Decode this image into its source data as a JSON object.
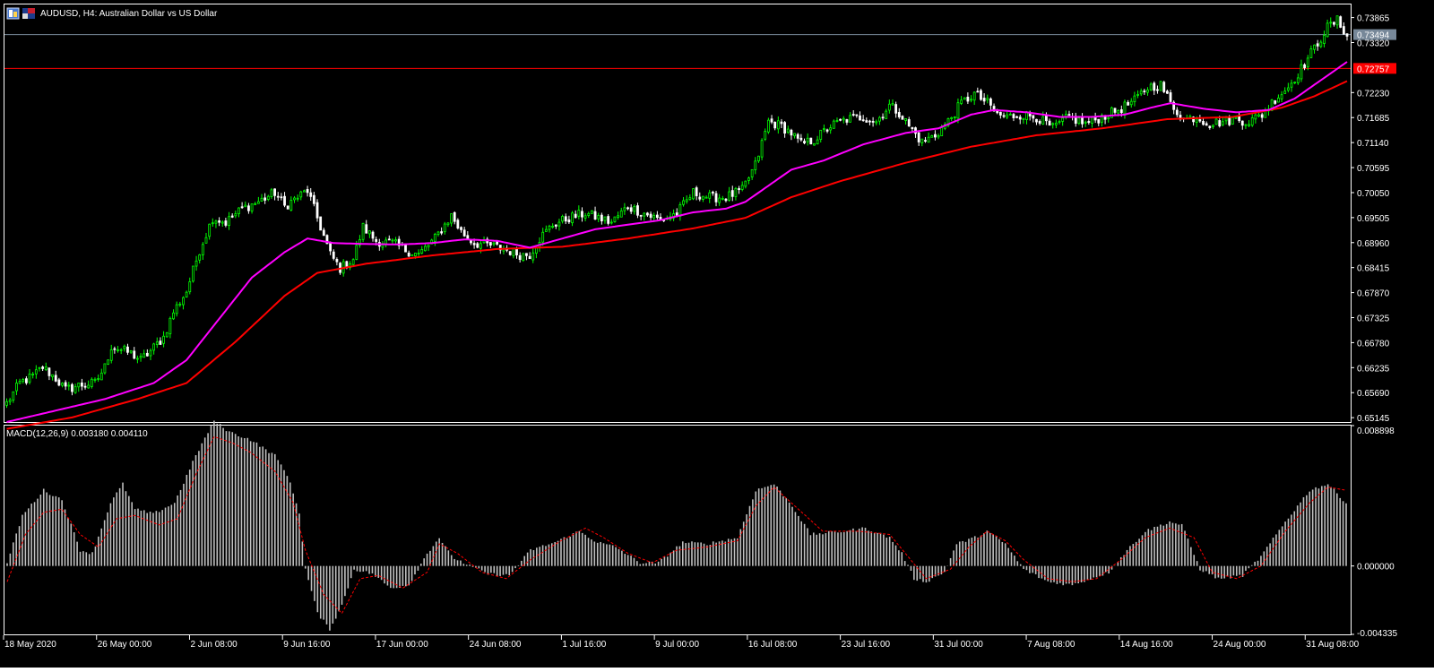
{
  "header": {
    "symbol_title": "AUDUSD, H4:  Australian Dollar vs US Dollar"
  },
  "colors": {
    "background": "#000000",
    "frame": "#ffffff",
    "text": "#ffffff",
    "bull_candle": "#00ff00",
    "bear_candle": "#ffffff",
    "ma_fast": "#ff00ff",
    "ma_slow": "#ff0000",
    "bid_line": "#778899",
    "ask_line": "#ff0000",
    "macd_histogram": "#c0c0c0",
    "macd_signal": "#ff0000"
  },
  "chart_data": [
    {
      "type": "candlestick",
      "name": "price",
      "title": "AUDUSD, H4:  Australian Dollar vs US Dollar",
      "ylim": [
        0.6505,
        0.7415
      ],
      "y_ticks": [
        "0.73865",
        "0.73320",
        "0.72230",
        "0.71685",
        "0.71140",
        "0.70595",
        "0.70050",
        "0.69505",
        "0.68960",
        "0.68415",
        "0.67870",
        "0.67325",
        "0.66780",
        "0.66235",
        "0.65690",
        "0.65145"
      ],
      "bid_label": "0.73494",
      "bid_value": 0.73494,
      "ask_label": "0.72757",
      "ask_value": 0.72757,
      "grid": false,
      "close_path": [
        [
          0,
          0.6546
        ],
        [
          4,
          0.659
        ],
        [
          8,
          0.6605
        ],
        [
          11,
          0.6625
        ],
        [
          15,
          0.66
        ],
        [
          18,
          0.6575
        ],
        [
          22,
          0.6585
        ],
        [
          27,
          0.659
        ],
        [
          30,
          0.6625
        ],
        [
          32,
          0.667
        ],
        [
          38,
          0.6655
        ],
        [
          41,
          0.664
        ],
        [
          44,
          0.666
        ],
        [
          48,
          0.669
        ],
        [
          51,
          0.6745
        ],
        [
          55,
          0.679
        ],
        [
          59,
          0.688
        ],
        [
          63,
          0.695
        ],
        [
          67,
          0.694
        ],
        [
          72,
          0.697
        ],
        [
          77,
          0.6985
        ],
        [
          82,
          0.7005
        ],
        [
          85,
          0.6975
        ],
        [
          88,
          0.699
        ],
        [
          92,
          0.701
        ],
        [
          96,
          0.693
        ],
        [
          99,
          0.687
        ],
        [
          102,
          0.684
        ],
        [
          106,
          0.686
        ],
        [
          109,
          0.693
        ],
        [
          113,
          0.69
        ],
        [
          118,
          0.6895
        ],
        [
          122,
          0.688
        ],
        [
          126,
          0.687
        ],
        [
          131,
          0.6905
        ],
        [
          136,
          0.6955
        ],
        [
          139,
          0.692
        ],
        [
          143,
          0.6895
        ],
        [
          148,
          0.689
        ],
        [
          153,
          0.688
        ],
        [
          157,
          0.687
        ],
        [
          160,
          0.687
        ],
        [
          163,
          0.6905
        ],
        [
          167,
          0.6935
        ],
        [
          172,
          0.695
        ],
        [
          177,
          0.696
        ],
        [
          181,
          0.695
        ],
        [
          185,
          0.694
        ],
        [
          190,
          0.6975
        ],
        [
          195,
          0.696
        ],
        [
          200,
          0.6945
        ],
        [
          205,
          0.696
        ],
        [
          210,
          0.7005
        ],
        [
          215,
          0.6995
        ],
        [
          220,
          0.6995
        ],
        [
          225,
          0.701
        ],
        [
          229,
          0.7065
        ],
        [
          233,
          0.716
        ],
        [
          237,
          0.715
        ],
        [
          240,
          0.7135
        ],
        [
          243,
          0.711
        ],
        [
          247,
          0.712
        ],
        [
          252,
          0.715
        ],
        [
          257,
          0.7165
        ],
        [
          262,
          0.717
        ],
        [
          266,
          0.716
        ],
        [
          270,
          0.7195
        ],
        [
          273,
          0.718
        ],
        [
          276,
          0.715
        ],
        [
          280,
          0.7115
        ],
        [
          284,
          0.713
        ],
        [
          288,
          0.716
        ],
        [
          292,
          0.72
        ],
        [
          296,
          0.722
        ],
        [
          300,
          0.72
        ],
        [
          303,
          0.7175
        ],
        [
          306,
          0.717
        ],
        [
          310,
          0.7175
        ],
        [
          315,
          0.717
        ],
        [
          320,
          0.7145
        ],
        [
          325,
          0.717
        ],
        [
          330,
          0.7155
        ],
        [
          335,
          0.717
        ],
        [
          340,
          0.7185
        ],
        [
          345,
          0.7205
        ],
        [
          349,
          0.7235
        ],
        [
          353,
          0.724
        ],
        [
          356,
          0.72
        ],
        [
          360,
          0.7165
        ],
        [
          364,
          0.717
        ],
        [
          368,
          0.7155
        ],
        [
          372,
          0.716
        ],
        [
          376,
          0.7165
        ],
        [
          380,
          0.716
        ],
        [
          384,
          0.7175
        ],
        [
          388,
          0.721
        ],
        [
          392,
          0.7235
        ],
        [
          396,
          0.7275
        ],
        [
          400,
          0.732
        ],
        [
          404,
          0.7365
        ],
        [
          407,
          0.738
        ],
        [
          410,
          0.7349
        ]
      ],
      "ma_fast_path": [
        [
          0,
          0.6505
        ],
        [
          30,
          0.6555
        ],
        [
          45,
          0.659
        ],
        [
          55,
          0.664
        ],
        [
          65,
          0.673
        ],
        [
          75,
          0.682
        ],
        [
          85,
          0.6875
        ],
        [
          92,
          0.6905
        ],
        [
          100,
          0.6895
        ],
        [
          110,
          0.6893
        ],
        [
          120,
          0.6892
        ],
        [
          130,
          0.6895
        ],
        [
          140,
          0.6903
        ],
        [
          150,
          0.69
        ],
        [
          160,
          0.6885
        ],
        [
          170,
          0.6905
        ],
        [
          180,
          0.6925
        ],
        [
          190,
          0.6935
        ],
        [
          200,
          0.6945
        ],
        [
          210,
          0.6962
        ],
        [
          220,
          0.697
        ],
        [
          226,
          0.6985
        ],
        [
          232,
          0.7015
        ],
        [
          240,
          0.7055
        ],
        [
          250,
          0.7075
        ],
        [
          262,
          0.711
        ],
        [
          275,
          0.7135
        ],
        [
          285,
          0.7145
        ],
        [
          295,
          0.7175
        ],
        [
          302,
          0.7185
        ],
        [
          312,
          0.718
        ],
        [
          322,
          0.717
        ],
        [
          332,
          0.717
        ],
        [
          342,
          0.7175
        ],
        [
          350,
          0.719
        ],
        [
          356,
          0.72
        ],
        [
          366,
          0.7188
        ],
        [
          376,
          0.718
        ],
        [
          386,
          0.7185
        ],
        [
          394,
          0.721
        ],
        [
          402,
          0.725
        ],
        [
          410,
          0.729
        ]
      ],
      "ma_slow_path": [
        [
          0,
          0.649
        ],
        [
          20,
          0.6515
        ],
        [
          40,
          0.6555
        ],
        [
          55,
          0.659
        ],
        [
          70,
          0.668
        ],
        [
          85,
          0.678
        ],
        [
          95,
          0.683
        ],
        [
          110,
          0.685
        ],
        [
          130,
          0.6868
        ],
        [
          150,
          0.6882
        ],
        [
          170,
          0.6887
        ],
        [
          190,
          0.6905
        ],
        [
          210,
          0.6927
        ],
        [
          226,
          0.695
        ],
        [
          240,
          0.6995
        ],
        [
          255,
          0.703
        ],
        [
          275,
          0.707
        ],
        [
          295,
          0.7105
        ],
        [
          315,
          0.713
        ],
        [
          335,
          0.7145
        ],
        [
          355,
          0.7165
        ],
        [
          375,
          0.717
        ],
        [
          390,
          0.719
        ],
        [
          400,
          0.7215
        ],
        [
          410,
          0.7248
        ]
      ]
    },
    {
      "type": "bar",
      "name": "macd",
      "title": "MACD(12,26,9) 0.003180 0.004110",
      "parameters": "12,26,9",
      "macd_value": 0.00318,
      "signal_value": 0.00411,
      "ylim": [
        -0.004335,
        0.008898
      ],
      "y_ticks": [
        "0.008898",
        "0.000000",
        "-0.004335"
      ],
      "histogram_path": [
        [
          0,
          0.0002
        ],
        [
          5,
          0.0032
        ],
        [
          12,
          0.0048
        ],
        [
          18,
          0.0042
        ],
        [
          24,
          0.001
        ],
        [
          28,
          0.0008
        ],
        [
          34,
          0.004
        ],
        [
          38,
          0.0052
        ],
        [
          42,
          0.0036
        ],
        [
          48,
          0.0033
        ],
        [
          55,
          0.004
        ],
        [
          62,
          0.007
        ],
        [
          68,
          0.0092
        ],
        [
          73,
          0.0085
        ],
        [
          80,
          0.008
        ],
        [
          88,
          0.007
        ],
        [
          92,
          0.0058
        ],
        [
          96,
          0.0034
        ],
        [
          98,
          -0.0002
        ],
        [
          102,
          -0.003
        ],
        [
          106,
          -0.004
        ],
        [
          110,
          -0.0025
        ],
        [
          114,
          -0.0002
        ],
        [
          120,
          -0.0005
        ],
        [
          126,
          -0.0014
        ],
        [
          132,
          -0.0012
        ],
        [
          138,
          0.0008
        ],
        [
          142,
          0.0018
        ],
        [
          146,
          0.0006
        ],
        [
          152,
          0.0
        ],
        [
          158,
          -0.0005
        ],
        [
          165,
          -0.0006
        ],
        [
          172,
          0.001
        ],
        [
          180,
          0.0015
        ],
        [
          188,
          0.0022
        ],
        [
          194,
          0.0015
        ],
        [
          200,
          0.0012
        ],
        [
          208,
          0.0002
        ],
        [
          214,
          0.0002
        ],
        [
          222,
          0.0015
        ],
        [
          230,
          0.0014
        ],
        [
          240,
          0.0018
        ],
        [
          246,
          0.0048
        ],
        [
          252,
          0.0052
        ],
        [
          258,
          0.0038
        ],
        [
          264,
          0.002
        ],
        [
          275,
          0.0022
        ],
        [
          282,
          0.0024
        ],
        [
          290,
          0.0018
        ],
        [
          294,
          0.0008
        ],
        [
          298,
          -0.0008
        ],
        [
          302,
          -0.001
        ],
        [
          308,
          -0.0004
        ],
        [
          312,
          0.0014
        ],
        [
          318,
          0.0018
        ],
        [
          322,
          0.0022
        ],
        [
          328,
          0.0014
        ],
        [
          334,
          -0.0002
        ],
        [
          342,
          -0.001
        ],
        [
          350,
          -0.0012
        ],
        [
          356,
          -0.0008
        ],
        [
          362,
          -0.0004
        ],
        [
          368,
          0.001
        ],
        [
          374,
          0.0022
        ],
        [
          382,
          0.0028
        ],
        [
          386,
          0.0026
        ],
        [
          392,
          -0.0002
        ],
        [
          398,
          -0.0008
        ],
        [
          406,
          -0.0006
        ],
        [
          412,
          0.0006
        ],
        [
          420,
          0.0028
        ],
        [
          428,
          0.0048
        ],
        [
          434,
          0.0052
        ],
        [
          440,
          0.004
        ]
      ],
      "signal_path": [
        [
          0,
          -0.001
        ],
        [
          6,
          0.002
        ],
        [
          12,
          0.0034
        ],
        [
          18,
          0.0036
        ],
        [
          24,
          0.002
        ],
        [
          30,
          0.0012
        ],
        [
          36,
          0.003
        ],
        [
          42,
          0.0032
        ],
        [
          50,
          0.0026
        ],
        [
          56,
          0.003
        ],
        [
          62,
          0.0058
        ],
        [
          68,
          0.0082
        ],
        [
          74,
          0.0078
        ],
        [
          80,
          0.0072
        ],
        [
          88,
          0.006
        ],
        [
          94,
          0.004
        ],
        [
          98,
          0.001
        ],
        [
          104,
          -0.0018
        ],
        [
          110,
          -0.003
        ],
        [
          116,
          -0.0008
        ],
        [
          122,
          -0.0006
        ],
        [
          130,
          -0.0014
        ],
        [
          138,
          -0.0004
        ],
        [
          142,
          0.0014
        ],
        [
          148,
          0.0008
        ],
        [
          156,
          -0.0004
        ],
        [
          164,
          -0.0008
        ],
        [
          172,
          0.0004
        ],
        [
          182,
          0.0016
        ],
        [
          190,
          0.0024
        ],
        [
          196,
          0.0018
        ],
        [
          204,
          0.0008
        ],
        [
          212,
          0.0002
        ],
        [
          220,
          0.001
        ],
        [
          230,
          0.0012
        ],
        [
          240,
          0.0016
        ],
        [
          246,
          0.0038
        ],
        [
          252,
          0.005
        ],
        [
          260,
          0.0036
        ],
        [
          268,
          0.0022
        ],
        [
          280,
          0.0022
        ],
        [
          290,
          0.002
        ],
        [
          296,
          0.0006
        ],
        [
          302,
          -0.0008
        ],
        [
          310,
          -0.0002
        ],
        [
          316,
          0.0012
        ],
        [
          322,
          0.0022
        ],
        [
          328,
          0.0016
        ],
        [
          334,
          0.0004
        ],
        [
          342,
          -0.0008
        ],
        [
          350,
          -0.001
        ],
        [
          358,
          -0.0008
        ],
        [
          366,
          0.0004
        ],
        [
          374,
          0.0018
        ],
        [
          382,
          0.0024
        ],
        [
          390,
          0.0018
        ],
        [
          396,
          -0.0004
        ],
        [
          404,
          -0.0008
        ],
        [
          412,
          0.0
        ],
        [
          420,
          0.0022
        ],
        [
          428,
          0.004
        ],
        [
          434,
          0.005
        ],
        [
          440,
          0.0048
        ]
      ]
    }
  ],
  "x_axis": {
    "labels": [
      "18 May 2020",
      "26 May 00:00",
      "2 Jun 08:00",
      "9 Jun 16:00",
      "17 Jun 00:00",
      "24 Jun 08:00",
      "1 Jul 16:00",
      "9 Jul 00:00",
      "16 Jul 08:00",
      "23 Jul 16:00",
      "31 Jul 00:00",
      "7 Aug 08:00",
      "14 Aug 16:00",
      "24 Aug 00:00",
      "31 Aug 08:00"
    ]
  }
}
